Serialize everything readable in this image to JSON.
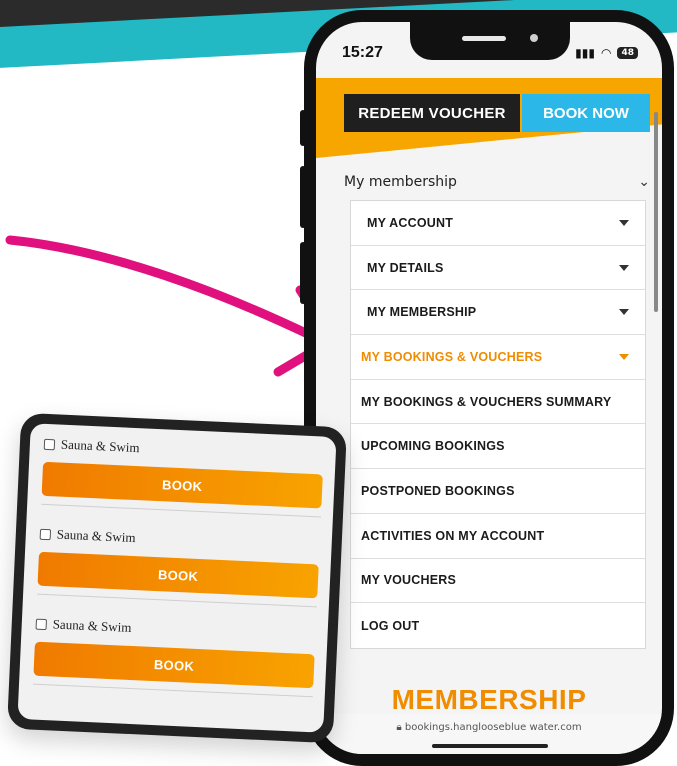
{
  "status_bar": {
    "time": "15:27",
    "battery": "48"
  },
  "header": {
    "redeem_label": "REDEEM VOUCHER",
    "book_label": "BOOK NOW"
  },
  "membership_section": {
    "label": "My membership"
  },
  "menu": {
    "items": [
      {
        "label": "MY ACCOUNT",
        "has_caret": true,
        "active": false
      },
      {
        "label": "MY DETAILS",
        "has_caret": true,
        "active": false
      },
      {
        "label": "MY MEMBERSHIP",
        "has_caret": true,
        "active": false
      },
      {
        "label": "MY BOOKINGS & VOUCHERS",
        "has_caret": true,
        "active": true
      },
      {
        "label": "MY BOOKINGS & VOUCHERS SUMMARY",
        "has_caret": false,
        "active": false
      },
      {
        "label": "UPCOMING BOOKINGS",
        "has_caret": false,
        "active": false
      },
      {
        "label": "POSTPONED BOOKINGS",
        "has_caret": false,
        "active": false
      },
      {
        "label": "ACTIVITIES ON MY ACCOUNT",
        "has_caret": false,
        "active": false
      },
      {
        "label": "MY VOUCHERS",
        "has_caret": false,
        "active": false
      },
      {
        "label": "LOG OUT",
        "has_caret": false,
        "active": false
      }
    ]
  },
  "footer": {
    "logo_text": "MEMBERSHIP",
    "url": "bookings.hanglooseblue water.com"
  },
  "inset_card": {
    "items": [
      {
        "label": "Sauna & Swim",
        "button": "BOOK"
      },
      {
        "label": "Sauna & Swim",
        "button": "BOOK"
      },
      {
        "label": "Sauna & Swim",
        "button": "BOOK"
      }
    ]
  },
  "colors": {
    "accent_orange": "#f08c00",
    "brand_yellow": "#f7a600",
    "book_blue": "#2bb8e8",
    "arrow_pink": "#e0107e",
    "teal_band": "#22b8c4"
  }
}
